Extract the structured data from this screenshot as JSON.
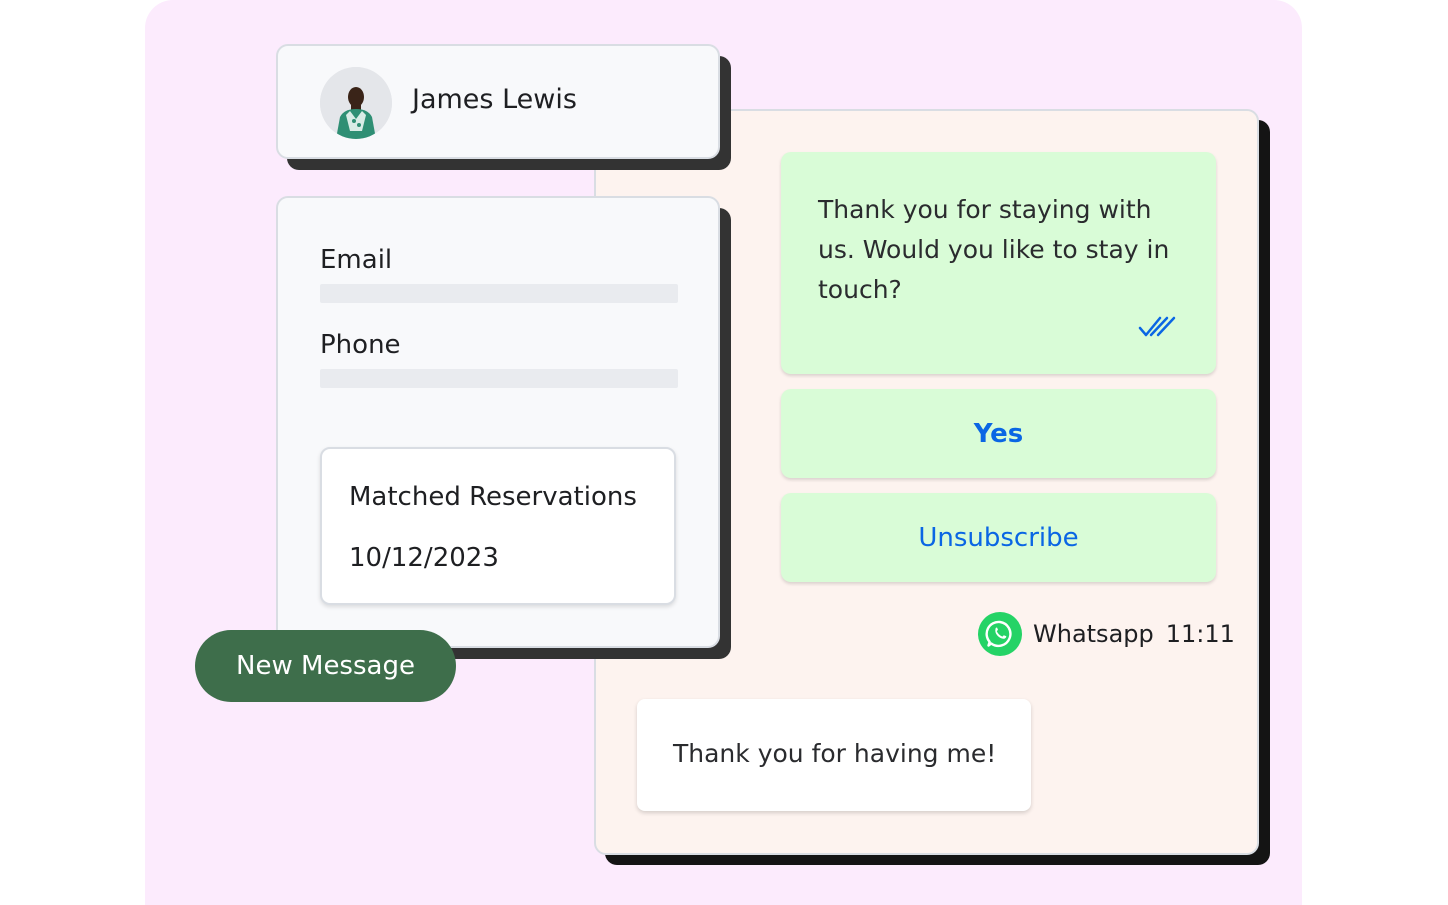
{
  "contact": {
    "name": "James Lewis",
    "avatar_icon": "person-avatar-icon"
  },
  "details": {
    "email_label": "Email",
    "email_value": "",
    "phone_label": "Phone",
    "phone_value": "",
    "reservations": {
      "title": "Matched Reservations",
      "date": "10/12/2023"
    }
  },
  "actions": {
    "new_message_label": "New Message"
  },
  "chat": {
    "incoming_message": "Thank you for staying with us. Would you like to stay in touch?",
    "read_status_icon": "double-check-icon",
    "quick_replies": [
      {
        "label": "Yes"
      },
      {
        "label": "Unsubscribe"
      }
    ],
    "channel": "Whatsapp",
    "channel_icon": "whatsapp-icon",
    "time": "11:11",
    "outgoing_message": "Thank you for having me!"
  },
  "colors": {
    "background": "#fcebfd",
    "chat_panel": "#fdf3ef",
    "bubble_green": "#d9fcd7",
    "link_blue": "#0a66e4",
    "button_green": "#3e6e4b",
    "whatsapp_green": "#25d366"
  }
}
